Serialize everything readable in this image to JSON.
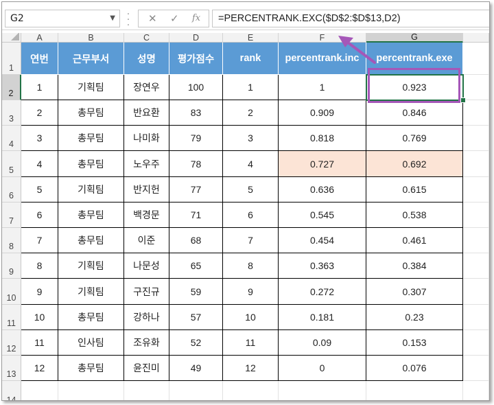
{
  "name_box": {
    "value": "G2"
  },
  "formula_bar": {
    "cancel_glyph": "✕",
    "enter_glyph": "✓",
    "fx_label": "fx",
    "formula": "=PERCENTRANK.EXC($D$2:$D$13,D2)"
  },
  "columns": [
    "A",
    "B",
    "C",
    "D",
    "E",
    "F",
    "G"
  ],
  "rows": [
    "1",
    "2",
    "3",
    "4",
    "5",
    "6",
    "7",
    "8",
    "9",
    "10",
    "11",
    "12",
    "13",
    "14"
  ],
  "table": {
    "headers": [
      "연번",
      "근무부서",
      "성명",
      "평가점수",
      "rank",
      "percentrank.inc",
      "percentrank.exe"
    ],
    "rows": [
      [
        "1",
        "기획팀",
        "장연우",
        "100",
        "1",
        "1",
        "0.923"
      ],
      [
        "2",
        "총무팀",
        "반요환",
        "83",
        "2",
        "0.909",
        "0.846"
      ],
      [
        "3",
        "총무팀",
        "나미화",
        "79",
        "3",
        "0.818",
        "0.769"
      ],
      [
        "4",
        "총무팀",
        "노우주",
        "78",
        "4",
        "0.727",
        "0.692"
      ],
      [
        "5",
        "기획팀",
        "반지헌",
        "77",
        "5",
        "0.636",
        "0.615"
      ],
      [
        "6",
        "총무팀",
        "백경문",
        "71",
        "6",
        "0.545",
        "0.538"
      ],
      [
        "7",
        "총무팀",
        "이준",
        "68",
        "7",
        "0.454",
        "0.461"
      ],
      [
        "8",
        "기획팀",
        "나문성",
        "65",
        "8",
        "0.363",
        "0.384"
      ],
      [
        "9",
        "기획팀",
        "구진규",
        "59",
        "9",
        "0.272",
        "0.307"
      ],
      [
        "10",
        "총무팀",
        "강하나",
        "57",
        "10",
        "0.181",
        "0.23"
      ],
      [
        "11",
        "인사팀",
        "조유화",
        "52",
        "11",
        "0.09",
        "0.153"
      ],
      [
        "12",
        "총무팀",
        "윤진미",
        "49",
        "12",
        "0",
        "0.076"
      ]
    ]
  },
  "selected_cell": "G2",
  "highlighted_row": "5",
  "colors": {
    "header_fill": "#5b9bd5",
    "highlight_fill": "#fce4d6",
    "annotation": "#a557b8",
    "selection": "#217346"
  }
}
